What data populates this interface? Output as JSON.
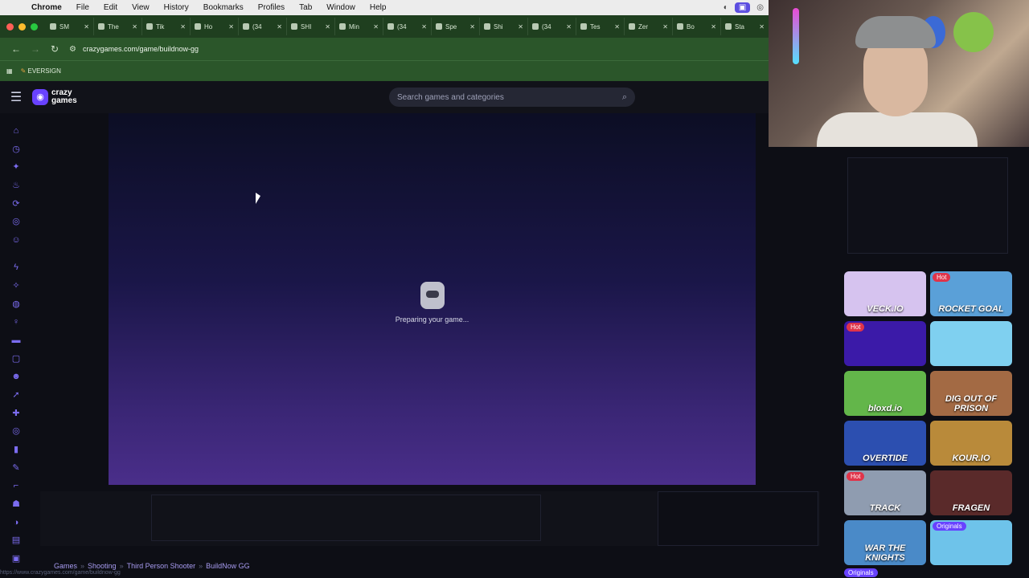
{
  "menubar": {
    "app": "Chrome",
    "items": [
      "File",
      "Edit",
      "View",
      "History",
      "Bookmarks",
      "Profiles",
      "Tab",
      "Window",
      "Help"
    ]
  },
  "tabs": [
    {
      "label": "SM"
    },
    {
      "label": "The"
    },
    {
      "label": "Tik"
    },
    {
      "label": "Ho"
    },
    {
      "label": "(34"
    },
    {
      "label": "SHI"
    },
    {
      "label": "Min"
    },
    {
      "label": "(34"
    },
    {
      "label": "Spe"
    },
    {
      "label": "Shi"
    },
    {
      "label": "(34"
    },
    {
      "label": "Tes"
    },
    {
      "label": "Zer"
    },
    {
      "label": "Bo"
    },
    {
      "label": "Sta"
    }
  ],
  "toolbar": {
    "url": "crazygames.com/game/buildnow-gg"
  },
  "bookmarks": {
    "item1": "EVERSIGN"
  },
  "site": {
    "logo_line1": "crazy",
    "logo_line2": "games",
    "search_placeholder": "Search games and categories"
  },
  "game": {
    "loading_text": "Preparing your game..."
  },
  "breadcrumb": [
    "Games",
    "Shooting",
    "Third Person Shooter",
    "BuildNow GG"
  ],
  "status_url": "https://www.crazygames.com/game/buildnow-gg",
  "thumbnails": [
    {
      "title": "VECK.IO",
      "badge": "",
      "color": "#d6c3ef"
    },
    {
      "title": "ROCKET GOAL",
      "badge": "Hot",
      "color": "#5aa0d8"
    },
    {
      "title": "",
      "badge": "Hot",
      "color": "#3b1aa8"
    },
    {
      "title": "",
      "badge": "",
      "color": "#7fd0f0"
    },
    {
      "title": "bloxd.io",
      "badge": "",
      "color": "#63b64a"
    },
    {
      "title": "DIG OUT OF PRISON",
      "badge": "",
      "color": "#a36a44"
    },
    {
      "title": "OVERTIDE",
      "badge": "",
      "color": "#2c4fb0"
    },
    {
      "title": "KOUR.IO",
      "badge": "",
      "color": "#b98a3a"
    },
    {
      "title": "TRACK",
      "badge": "Hot",
      "color": "#8f9cb0"
    },
    {
      "title": "FRAGEN",
      "badge": "",
      "color": "#5a2a2a"
    },
    {
      "title": "WAR THE KNIGHTS",
      "badge": "",
      "color": "#4a8ac8"
    },
    {
      "title": "",
      "badge": "Originals",
      "color": "#6ec3ea"
    }
  ],
  "extra_badge": "Originals"
}
